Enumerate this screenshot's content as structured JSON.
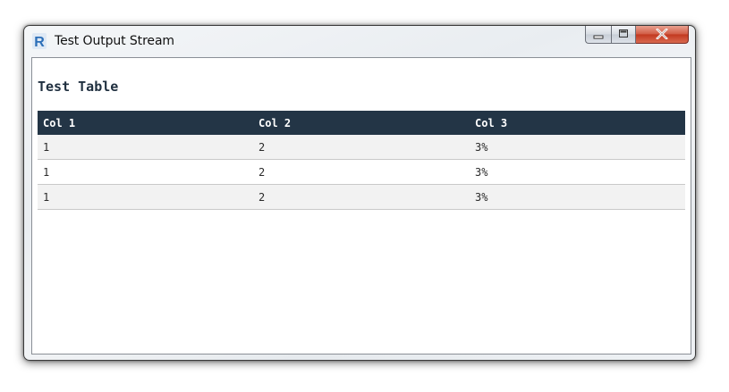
{
  "window": {
    "title": "Test Output Stream",
    "app_icon": "revit-r-icon"
  },
  "caption": {
    "minimize_icon": "minimize-icon",
    "maximize_icon": "maximize-icon",
    "close_icon": "close-icon"
  },
  "report": {
    "title": "Test Table"
  },
  "table": {
    "headers": [
      "Col 1",
      "Col 2",
      "Col 3"
    ],
    "rows": [
      [
        "1",
        "2",
        "3%"
      ],
      [
        "1",
        "2",
        "3%"
      ],
      [
        "1",
        "2",
        "3%"
      ]
    ]
  },
  "colors": {
    "header_bg": "#233546",
    "header_text": "#ffffff",
    "stripe": "#f2f2f2",
    "title_text": "#1f2f3f",
    "icon_blue": "#2d6fb8"
  }
}
